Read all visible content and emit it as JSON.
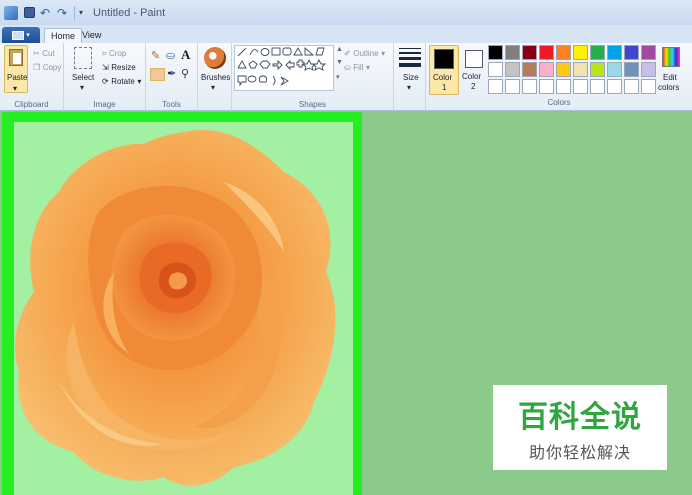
{
  "window": {
    "title": "Untitled - Paint"
  },
  "quick_access": {
    "icons": [
      "paint-app-icon",
      "save-icon",
      "undo-icon",
      "redo-icon",
      "customize-dropdown-icon"
    ]
  },
  "tabs": [
    {
      "label": "Home",
      "active": true
    },
    {
      "label": "View",
      "active": false
    }
  ],
  "clipboard": {
    "paste": "Paste",
    "cut": "Cut",
    "copy": "Copy",
    "group": "Clipboard"
  },
  "image": {
    "select": "Select",
    "crop": "Crop",
    "resize": "Resize",
    "rotate": "Rotate",
    "group": "Image"
  },
  "tools": {
    "group": "Tools",
    "items": [
      "pencil-icon",
      "fill-icon",
      "text-icon",
      "eraser-icon",
      "color-picker-icon",
      "magnifier-icon"
    ]
  },
  "brushes": {
    "label": "Brushes"
  },
  "shapes": {
    "outline": "Outline",
    "fill": "Fill",
    "group": "Shapes"
  },
  "size": {
    "label": "Size"
  },
  "color1": {
    "label": "Color",
    "num": "1",
    "value": "#000000"
  },
  "color2": {
    "label": "Color",
    "num": "2",
    "value": "#ffffff"
  },
  "colors": {
    "group": "Colors",
    "edit_label": "Edit",
    "edit_label2": "colors",
    "row1": [
      "#000000",
      "#7f7f7f",
      "#880015",
      "#ed1c24",
      "#ff7f27",
      "#fff200",
      "#22b14c",
      "#00a2e8",
      "#3f48cc",
      "#a349a4"
    ],
    "row2": [
      "#ffffff",
      "#c3c3c3",
      "#b97a57",
      "#ffaec9",
      "#ffc90e",
      "#efe4b0",
      "#b5e61d",
      "#99d9ea",
      "#7092be",
      "#c8bfe7"
    ]
  },
  "canvas": {
    "border_color": "#22ee22",
    "fill_color": "#a3f0a3",
    "content": "orange-rose-image"
  },
  "watermark": {
    "title": "百科全说",
    "subtitle": "助你轻松解决"
  }
}
